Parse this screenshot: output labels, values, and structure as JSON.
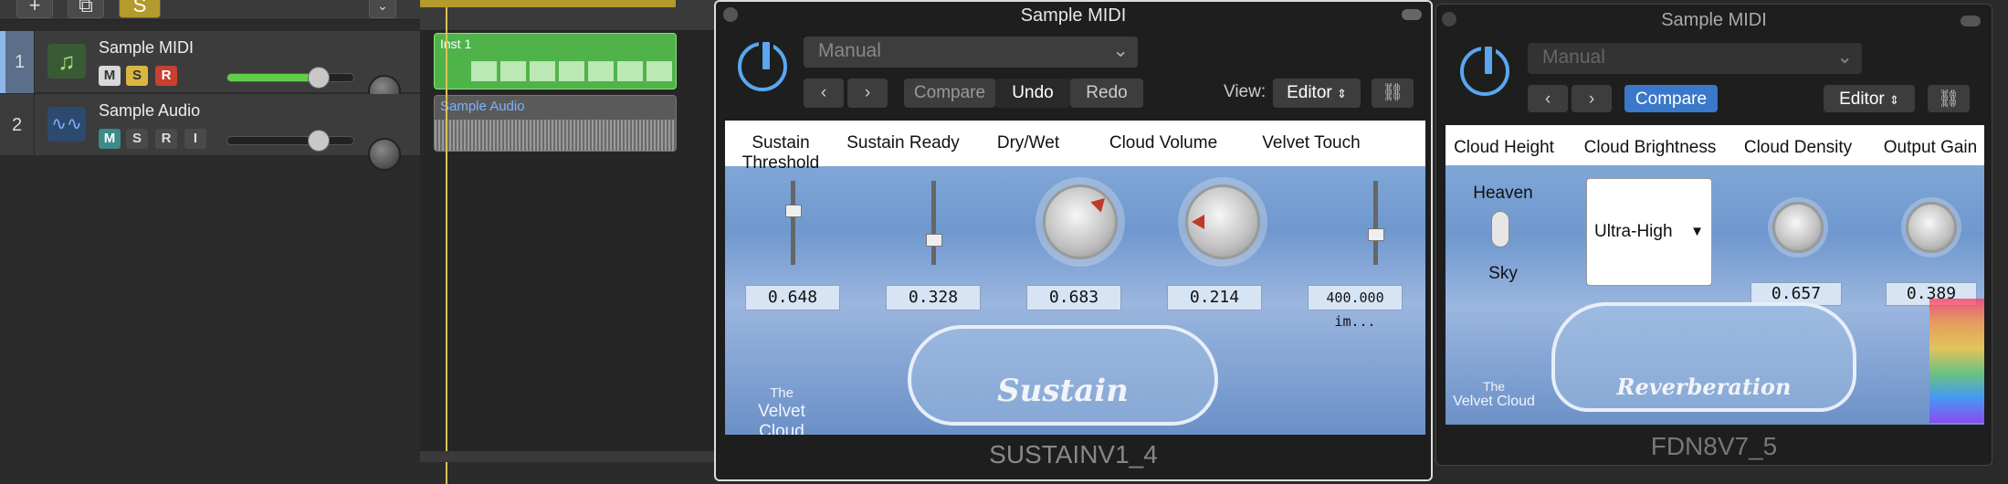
{
  "toolbar": {
    "add_label": "+",
    "solo_label": "S"
  },
  "tracks": [
    {
      "number": "1",
      "name": "Sample MIDI",
      "m": "M",
      "s": "S",
      "r": "R",
      "volume_level": 0.85
    },
    {
      "number": "2",
      "name": "Sample Audio",
      "m": "M",
      "s": "S",
      "r": "R",
      "i": "I",
      "volume_level": 0.75
    }
  ],
  "regions": {
    "midi_label": "Inst 1",
    "audio_label": "Sample Audio"
  },
  "plugin1": {
    "title": "Sample MIDI",
    "preset": "Manual",
    "compare": "Compare",
    "undo": "Undo",
    "redo": "Redo",
    "view_label": "View:",
    "view_value": "Editor",
    "params": [
      {
        "label": "Sustain Threshold",
        "value": "0.648"
      },
      {
        "label": "Sustain Ready",
        "value": "0.328"
      },
      {
        "label": "Dry/Wet",
        "value": "0.683"
      },
      {
        "label": "Cloud Volume",
        "value": "0.214"
      },
      {
        "label": "Velvet Touch",
        "value": "400.000 im..."
      }
    ],
    "logo_line1": "The",
    "logo_line2": "Velvet Cloud",
    "art_text": "Sustain",
    "footer": "SUSTAINV1_4"
  },
  "plugin2": {
    "title": "Sample MIDI",
    "preset": "Manual",
    "compare": "Compare",
    "view_value": "Editor",
    "params": [
      {
        "label": "Cloud Height",
        "value_top": "Heaven",
        "value_bottom": "Sky"
      },
      {
        "label": "Cloud Brightness",
        "value": "Ultra-High"
      },
      {
        "label": "Cloud Density",
        "value": "0.657"
      },
      {
        "label": "Output Gain",
        "value": "0.389"
      }
    ],
    "logo_line1": "The",
    "logo_line2": "Velvet Cloud",
    "art_text": "Reverberation",
    "footer": "FDN8V7_5"
  },
  "colors": {
    "accent": "#5aa7f0",
    "region_green": "#4fb34a",
    "mute_teal": "#3c8a8a",
    "solo_yellow": "#d9b640",
    "rec_red": "#c8402f"
  }
}
